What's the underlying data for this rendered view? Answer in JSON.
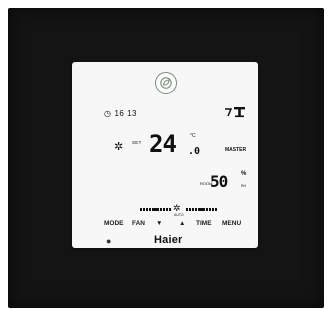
{
  "lcd": {
    "clock_icon": "clock-icon",
    "clock_time": "16 13",
    "mode_icon": "swing-thermostat-icon",
    "fan_icon": "fan-icon",
    "set_label": "SET",
    "set_temp": "24",
    "set_temp_decimal": ".0",
    "temp_unit": "°C",
    "master_label": "MASTER",
    "room_label": "ROOM",
    "humidity": "50",
    "humidity_unit": "%",
    "rh_label": "RH",
    "fan_speed_icon": "fan-speed-icon",
    "auto_label": "AUTO"
  },
  "buttons": {
    "mode": "MODE",
    "fan": "FAN",
    "down": "▼",
    "up": "▲",
    "time": "TIME",
    "menu": "MENU"
  },
  "brand": {
    "name": "Haier",
    "sensor_icon": "sensor-dot-icon",
    "eco_icon": "leaf-icon"
  },
  "colors": {
    "panel": "#f7f7f7",
    "wall": "#141414",
    "eco_ring": "#7b8b7b"
  }
}
